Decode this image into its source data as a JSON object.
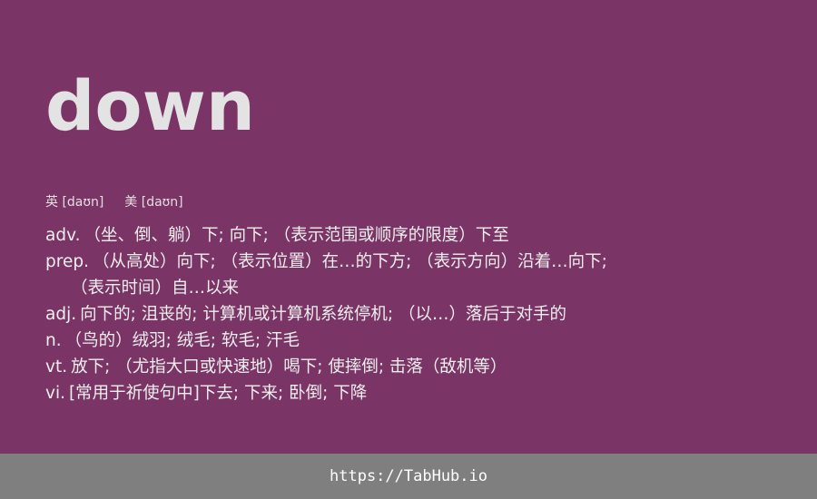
{
  "word": "down",
  "phonetics": {
    "uk_label": "英",
    "uk_ipa": "[daʊn]",
    "us_label": "美",
    "us_ipa": "[daʊn]"
  },
  "definitions": [
    {
      "pos": "adv.",
      "text": "（坐、倒、躺）下; 向下; （表示范围或顺序的限度）下至"
    },
    {
      "pos": "prep.",
      "text": "（从高处）向下; （表示位置）在…的下方; （表示方向）沿着…向下;"
    },
    {
      "pos": "",
      "text": "（表示时间）自…以来"
    },
    {
      "pos": "adj.",
      "text": "向下的; 沮丧的; 计算机或计算机系统停机; （以…）落后于对手的"
    },
    {
      "pos": "n.",
      "text": "（鸟的）绒羽; 绒毛; 软毛; 汗毛"
    },
    {
      "pos": "vt.",
      "text": "放下; （尤指大口或快速地）喝下; 使摔倒; 击落（敌机等）"
    },
    {
      "pos": "vi.",
      "text": "[常用于祈使句中]下去; 下来; 卧倒; 下降"
    }
  ],
  "footer": {
    "link": "https://TabHub.io"
  },
  "colors": {
    "background": "#7a3566",
    "footer_background": "#7f7f7f",
    "word": "#e3e3e3",
    "text": "#eeeeee"
  }
}
